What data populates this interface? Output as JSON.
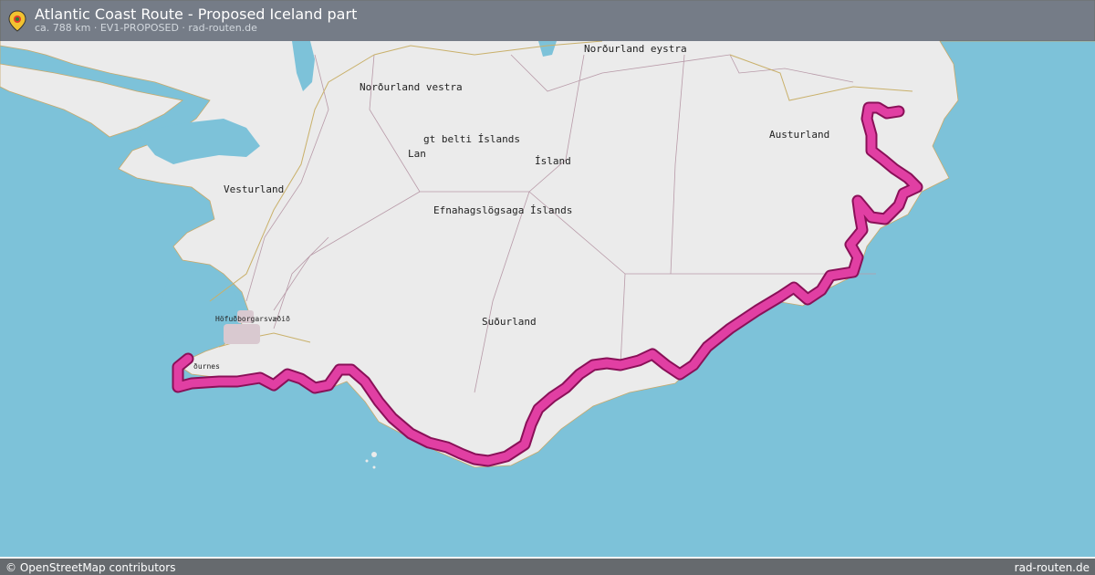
{
  "header": {
    "title": "Atlantic Coast Route - Proposed Iceland part",
    "subtitle": "ca. 788 km · EV1-PROPOSED · rad-routen.de"
  },
  "map": {
    "labels": {
      "nordurland_eystra": "Norðurland eystra",
      "nordurland_vestra": "Norðurland vestra",
      "austurland": "Austurland",
      "belti": "gt belti Íslands",
      "lan": "Lan",
      "island": "Ísland",
      "vesturland": "Vesturland",
      "efnahags": "Efnahagslögsaga Íslands",
      "hofudborgarsvaedid": "Höfuðborgarsvæðið",
      "sudurland": "Suðurland",
      "nes": "ðurnes"
    },
    "colors": {
      "sea": "#7dc2d9",
      "land": "#ebebeb",
      "route": "#e13fa3",
      "route_edge": "#8a1058"
    },
    "route_name": "EV1-PROPOSED"
  },
  "footer": {
    "attribution": "© OpenStreetMap contributors",
    "brand": "rad-routen.de"
  }
}
